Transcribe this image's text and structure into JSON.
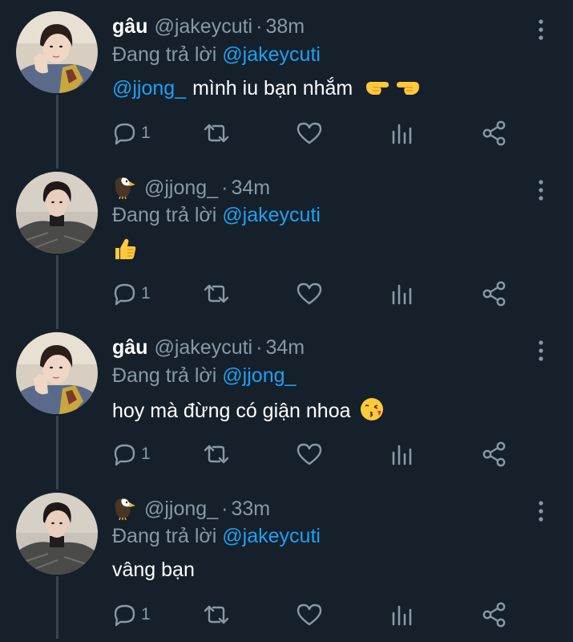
{
  "reply_prefix": "Đang trả lời",
  "tweets": [
    {
      "display_name": "gâu",
      "handle": "@jakeycuti",
      "dot": "·",
      "time": "38m",
      "replying_to": "@jakeycuti",
      "mention": "@jjong_",
      "text": "mình iu bạn nhắm",
      "emoji": "pointing-hands",
      "reply_count": "1",
      "avatar": "avatar-jakeycuti",
      "icons": [
        "reply-icon",
        "retweet-icon",
        "like-icon",
        "analytics-icon",
        "share-icon",
        "more-icon"
      ]
    },
    {
      "display_name": "",
      "display_emoji": "eagle-icon",
      "handle": "@jjong_",
      "dot": "·",
      "time": "34m",
      "replying_to": "@jakeycuti",
      "mention": "",
      "text": "",
      "emoji": "thumbs-up",
      "reply_count": "1",
      "avatar": "avatar-jjong"
    },
    {
      "display_name": "gâu",
      "handle": "@jakeycuti",
      "dot": "·",
      "time": "34m",
      "replying_to": "@jjong_",
      "mention": "",
      "text": "hoy mà đừng có giận nhoa",
      "emoji": "kissing-face",
      "reply_count": "1",
      "avatar": "avatar-jakeycuti"
    },
    {
      "display_name": "",
      "display_emoji": "eagle-icon",
      "handle": "@jjong_",
      "dot": "·",
      "time": "33m",
      "replying_to": "@jakeycuti",
      "mention": "",
      "text": "vâng bạn",
      "emoji": "",
      "reply_count": "1",
      "avatar": "avatar-jjong"
    }
  ],
  "colors": {
    "background": "#15202b",
    "secondary_text": "#8899a6",
    "link": "#1da1f2",
    "thread_line": "#38444d"
  }
}
